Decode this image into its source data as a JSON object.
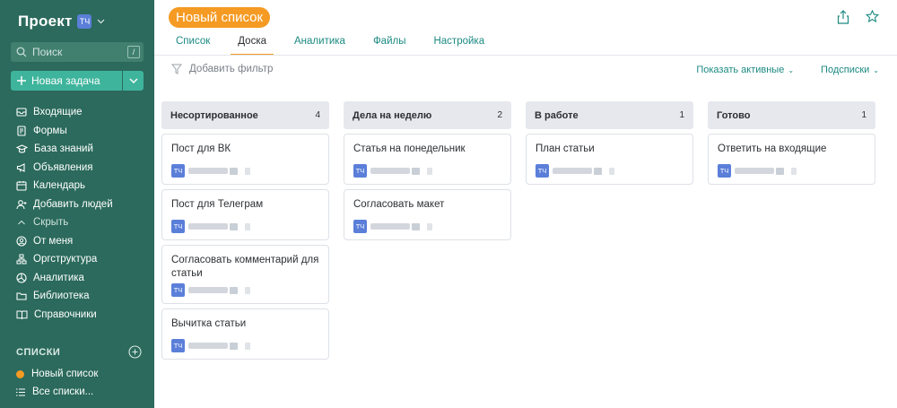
{
  "workspace": {
    "name": "Проект",
    "badge": "ТЧ"
  },
  "search": {
    "placeholder": "Поиск",
    "shortcut": "/"
  },
  "new_task": {
    "label": "Новая задача"
  },
  "nav": [
    {
      "label": "Входящие",
      "icon": "inbox-icon"
    },
    {
      "label": "Формы",
      "icon": "form-icon"
    },
    {
      "label": "База знаний",
      "icon": "graduation-cap-icon"
    },
    {
      "label": "Объявления",
      "icon": "megaphone-icon"
    },
    {
      "label": "Календарь",
      "icon": "calendar-icon"
    },
    {
      "label": "Добавить людей",
      "icon": "add-user-icon"
    },
    {
      "label": "Скрыть",
      "icon": "chevron-up-icon"
    },
    {
      "label": "От меня",
      "icon": "user-circle-icon"
    },
    {
      "label": "Оргструктура",
      "icon": "org-chart-icon"
    },
    {
      "label": "Аналитика",
      "icon": "pie-chart-icon"
    },
    {
      "label": "Библиотека",
      "icon": "folder-icon"
    },
    {
      "label": "Справочники",
      "icon": "book-icon"
    }
  ],
  "lists_section": {
    "title": "СПИСКИ",
    "items": [
      {
        "label": "Новый список",
        "icon": "orange-dot-icon",
        "color": "#f59a23"
      },
      {
        "label": "Все списки...",
        "icon": "list-icon"
      }
    ]
  },
  "header": {
    "title": "Новый список",
    "tabs": [
      {
        "label": "Список"
      },
      {
        "label": "Доска",
        "active": true
      },
      {
        "label": "Аналитика"
      },
      {
        "label": "Файлы"
      },
      {
        "label": "Настройка"
      }
    ]
  },
  "toolbar": {
    "filter_label": "Добавить фильтр",
    "show_active": "Показать активные",
    "subtasks": "Подсписки"
  },
  "colors": {
    "sidebar": "#2b6a5c",
    "accent": "#f59a23",
    "primary": "#3fb49c",
    "link": "#1c8a82",
    "avatar": "#5b7fd9"
  },
  "board": {
    "columns": [
      {
        "title": "Несортированное",
        "count": "4",
        "cards": [
          {
            "title": "Пост для ВК",
            "avatar": "ТЧ"
          },
          {
            "title": "Пост для Телеграм",
            "avatar": "ТЧ"
          },
          {
            "title": "Согласовать комментарий для статьи",
            "avatar": "ТЧ"
          },
          {
            "title": "Вычитка статьи",
            "avatar": "ТЧ"
          }
        ]
      },
      {
        "title": "Дела на неделю",
        "count": "2",
        "cards": [
          {
            "title": "Статья на понедельник",
            "avatar": "ТЧ"
          },
          {
            "title": "Согласовать макет",
            "avatar": "ТЧ"
          }
        ]
      },
      {
        "title": "В работе",
        "count": "1",
        "cards": [
          {
            "title": "План статьи",
            "avatar": "ТЧ"
          }
        ]
      },
      {
        "title": "Готово",
        "count": "1",
        "cards": [
          {
            "title": "Ответить на входящие",
            "avatar": "ТЧ"
          }
        ]
      }
    ]
  }
}
